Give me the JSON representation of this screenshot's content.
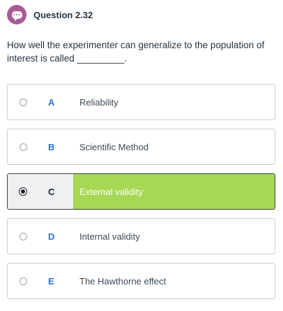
{
  "header": {
    "question_number": "Question 2.32",
    "icon": "chat-bubble-icon",
    "icon_color": "#a85c95"
  },
  "question": {
    "text": "How well the experimenter can generalize to the population of interest is called _________."
  },
  "colors": {
    "selected_answer_bg": "#a6d854",
    "letter_color": "#2a73d4"
  },
  "options": [
    {
      "letter": "A",
      "label": "Reliability",
      "selected": false
    },
    {
      "letter": "B",
      "label": "Scientific Method",
      "selected": false
    },
    {
      "letter": "C",
      "label": "External validity",
      "selected": true
    },
    {
      "letter": "D",
      "label": "Internal validity",
      "selected": false
    },
    {
      "letter": "E",
      "label": "The Hawthorne effect",
      "selected": false
    }
  ]
}
